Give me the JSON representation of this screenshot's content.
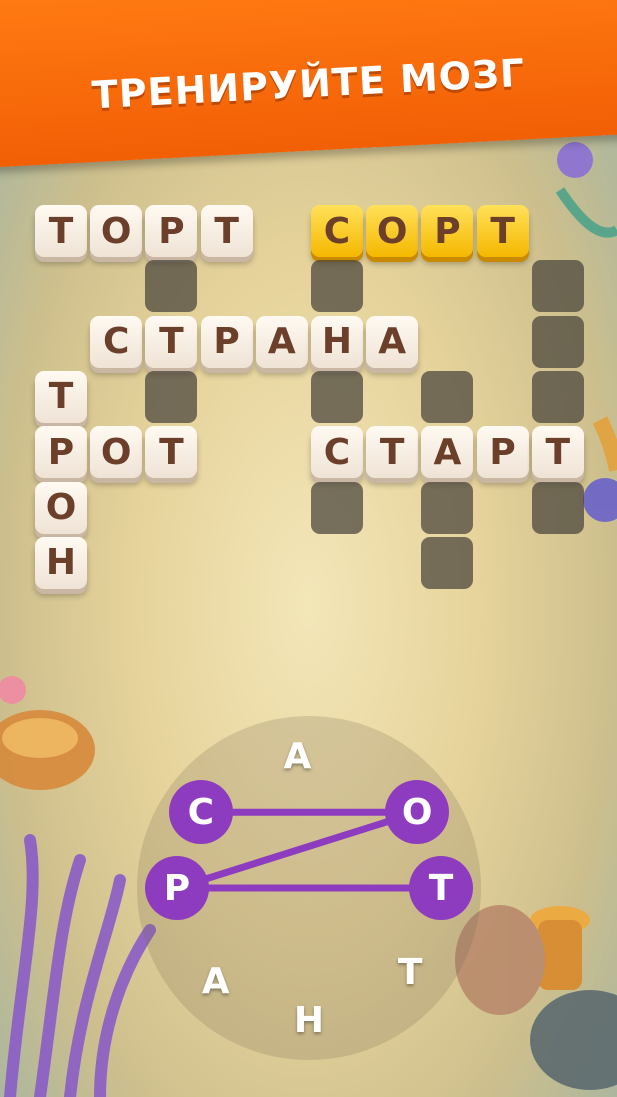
{
  "header": {
    "title": "ТРЕНИРУЙТЕ МОЗГ"
  },
  "board": {
    "cells": [
      {
        "r": 0,
        "c": 0,
        "l": "Т",
        "s": "filled"
      },
      {
        "r": 0,
        "c": 1,
        "l": "О",
        "s": "filled"
      },
      {
        "r": 0,
        "c": 2,
        "l": "Р",
        "s": "filled"
      },
      {
        "r": 0,
        "c": 3,
        "l": "Т",
        "s": "filled"
      },
      {
        "r": 0,
        "c": 5,
        "l": "С",
        "s": "gold"
      },
      {
        "r": 0,
        "c": 6,
        "l": "О",
        "s": "gold"
      },
      {
        "r": 0,
        "c": 7,
        "l": "Р",
        "s": "gold"
      },
      {
        "r": 0,
        "c": 8,
        "l": "Т",
        "s": "gold"
      },
      {
        "r": 1,
        "c": 2,
        "l": "",
        "s": "empty"
      },
      {
        "r": 1,
        "c": 5,
        "l": "",
        "s": "empty"
      },
      {
        "r": 1,
        "c": 9,
        "l": "",
        "s": "empty"
      },
      {
        "r": 2,
        "c": 1,
        "l": "С",
        "s": "filled"
      },
      {
        "r": 2,
        "c": 2,
        "l": "Т",
        "s": "filled"
      },
      {
        "r": 2,
        "c": 3,
        "l": "Р",
        "s": "filled"
      },
      {
        "r": 2,
        "c": 4,
        "l": "А",
        "s": "filled"
      },
      {
        "r": 2,
        "c": 5,
        "l": "Н",
        "s": "filled"
      },
      {
        "r": 2,
        "c": 6,
        "l": "А",
        "s": "filled"
      },
      {
        "r": 2,
        "c": 9,
        "l": "",
        "s": "empty"
      },
      {
        "r": 3,
        "c": 0,
        "l": "Т",
        "s": "filled"
      },
      {
        "r": 3,
        "c": 2,
        "l": "",
        "s": "empty"
      },
      {
        "r": 3,
        "c": 5,
        "l": "",
        "s": "empty"
      },
      {
        "r": 3,
        "c": 7,
        "l": "",
        "s": "empty"
      },
      {
        "r": 3,
        "c": 9,
        "l": "",
        "s": "empty"
      },
      {
        "r": 4,
        "c": 0,
        "l": "Р",
        "s": "filled"
      },
      {
        "r": 4,
        "c": 1,
        "l": "О",
        "s": "filled"
      },
      {
        "r": 4,
        "c": 2,
        "l": "Т",
        "s": "filled"
      },
      {
        "r": 4,
        "c": 5,
        "l": "С",
        "s": "filled"
      },
      {
        "r": 4,
        "c": 6,
        "l": "Т",
        "s": "filled"
      },
      {
        "r": 4,
        "c": 7,
        "l": "А",
        "s": "filled"
      },
      {
        "r": 4,
        "c": 8,
        "l": "Р",
        "s": "filled"
      },
      {
        "r": 4,
        "c": 9,
        "l": "Т",
        "s": "filled"
      },
      {
        "r": 5,
        "c": 0,
        "l": "О",
        "s": "filled"
      },
      {
        "r": 5,
        "c": 5,
        "l": "",
        "s": "empty"
      },
      {
        "r": 5,
        "c": 7,
        "l": "",
        "s": "empty"
      },
      {
        "r": 5,
        "c": 9,
        "l": "",
        "s": "empty"
      },
      {
        "r": 6,
        "c": 0,
        "l": "Н",
        "s": "filled"
      },
      {
        "r": 6,
        "c": 7,
        "l": "",
        "s": "empty"
      }
    ]
  },
  "wheel": {
    "letters": [
      {
        "l": "А",
        "selected": false,
        "angle": -95
      },
      {
        "l": "О",
        "selected": true,
        "angle": -35
      },
      {
        "l": "Т",
        "selected": true,
        "angle": 0
      },
      {
        "l": "Т",
        "selected": false,
        "angle": 40
      },
      {
        "l": "Н",
        "selected": false,
        "angle": 90
      },
      {
        "l": "А",
        "selected": false,
        "angle": 135
      },
      {
        "l": "Р",
        "selected": true,
        "angle": 180
      },
      {
        "l": "С",
        "selected": true,
        "angle": -145
      }
    ],
    "path_order": [
      "С",
      "О",
      "Р",
      "Т"
    ],
    "path_color": "#8e3cbf"
  },
  "colors": {
    "banner": "#f25f05",
    "gold_tile": "#f5b800",
    "selected_letter": "#8e3cbf",
    "letter_text": "#6b3f2a"
  }
}
